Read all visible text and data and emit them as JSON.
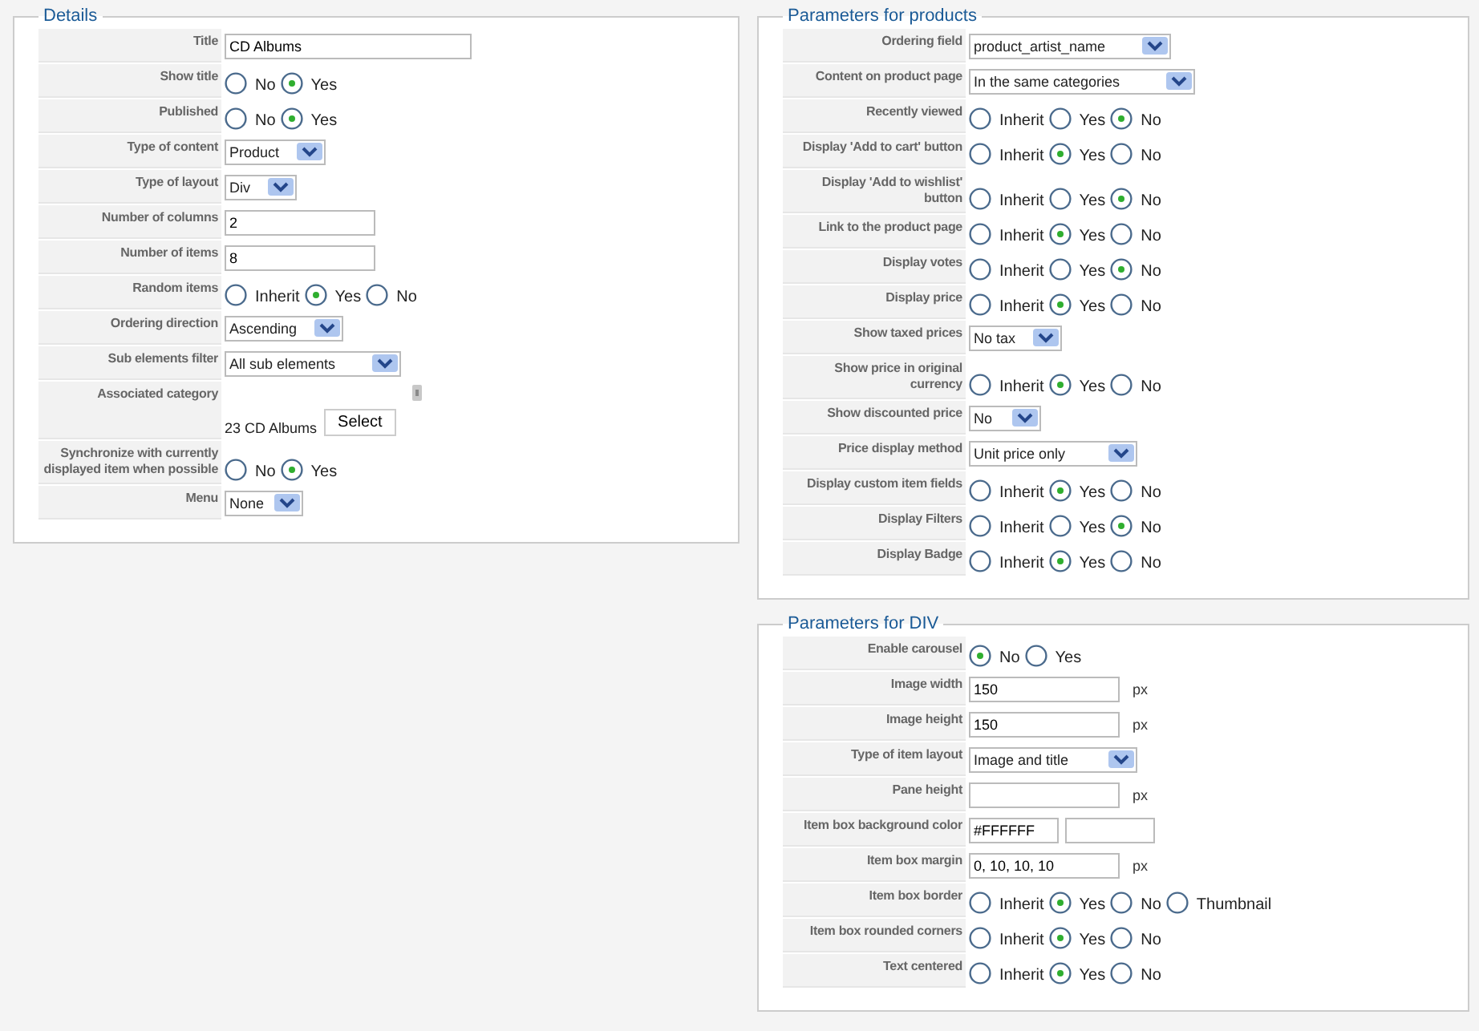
{
  "panels": [
    {
      "title": "Details",
      "rows": [
        {
          "label": "Title",
          "kind": "text",
          "value": "CD Albums"
        },
        {
          "label": "Show title",
          "kind": "radio",
          "options": [
            {
              "label": "No",
              "selected": false
            },
            {
              "label": "Yes",
              "selected": true
            }
          ]
        },
        {
          "label": "Published",
          "kind": "radio",
          "options": [
            {
              "label": "No",
              "selected": false
            },
            {
              "label": "Yes",
              "selected": true
            }
          ]
        },
        {
          "label": "Type of content",
          "kind": "select",
          "value": "Product"
        },
        {
          "label": "Type of layout",
          "kind": "select",
          "value": "Div"
        },
        {
          "label": "Number of columns",
          "kind": "text",
          "value": "2"
        },
        {
          "label": "Number of items",
          "kind": "text",
          "value": "8"
        },
        {
          "label": "Random items",
          "kind": "radio",
          "options": [
            {
              "label": "Inherit",
              "selected": false
            },
            {
              "label": "Yes",
              "selected": true
            },
            {
              "label": "No",
              "selected": false
            }
          ]
        },
        {
          "label": "Ordering direction",
          "kind": "select",
          "value": "Ascending"
        },
        {
          "label": "Sub elements filter",
          "kind": "select",
          "value": "All sub elements"
        },
        {
          "label": "Associated category",
          "kind": "category",
          "value": "23 CD Albums",
          "button": "Select"
        },
        {
          "label": "Synchronize with currently displayed item when possible",
          "kind": "radio",
          "options": [
            {
              "label": "No",
              "selected": false
            },
            {
              "label": "Yes",
              "selected": true
            }
          ]
        },
        {
          "label": "Menu",
          "kind": "select",
          "value": "None"
        }
      ]
    },
    {
      "title": "Parameters for products",
      "rows": [
        {
          "label": "Ordering field",
          "kind": "select",
          "value": "product_artist_name"
        },
        {
          "label": "Content on product page",
          "kind": "select",
          "value": "In the same categories"
        },
        {
          "label": "Recently viewed",
          "kind": "radio",
          "options": [
            {
              "label": "Inherit",
              "selected": false
            },
            {
              "label": "Yes",
              "selected": false
            },
            {
              "label": "No",
              "selected": true
            }
          ]
        },
        {
          "label": "Display 'Add to cart' button",
          "kind": "radio",
          "options": [
            {
              "label": "Inherit",
              "selected": false
            },
            {
              "label": "Yes",
              "selected": true
            },
            {
              "label": "No",
              "selected": false
            }
          ]
        },
        {
          "label": "Display 'Add to wishlist' button",
          "kind": "radio",
          "options": [
            {
              "label": "Inherit",
              "selected": false
            },
            {
              "label": "Yes",
              "selected": false
            },
            {
              "label": "No",
              "selected": true
            }
          ]
        },
        {
          "label": "Link to the product page",
          "kind": "radio",
          "options": [
            {
              "label": "Inherit",
              "selected": false
            },
            {
              "label": "Yes",
              "selected": true
            },
            {
              "label": "No",
              "selected": false
            }
          ]
        },
        {
          "label": "Display votes",
          "kind": "radio",
          "options": [
            {
              "label": "Inherit",
              "selected": false
            },
            {
              "label": "Yes",
              "selected": false
            },
            {
              "label": "No",
              "selected": true
            }
          ]
        },
        {
          "label": "Display price",
          "kind": "radio",
          "options": [
            {
              "label": "Inherit",
              "selected": false
            },
            {
              "label": "Yes",
              "selected": true
            },
            {
              "label": "No",
              "selected": false
            }
          ]
        },
        {
          "label": "Show taxed prices",
          "kind": "select",
          "value": "No tax"
        },
        {
          "label": "Show price in original currency",
          "kind": "radio",
          "options": [
            {
              "label": "Inherit",
              "selected": false
            },
            {
              "label": "Yes",
              "selected": true
            },
            {
              "label": "No",
              "selected": false
            }
          ]
        },
        {
          "label": "Show discounted price",
          "kind": "select",
          "value": "No"
        },
        {
          "label": "Price display method",
          "kind": "select",
          "value": "Unit price only"
        },
        {
          "label": "Display custom item fields",
          "kind": "radio",
          "options": [
            {
              "label": "Inherit",
              "selected": false
            },
            {
              "label": "Yes",
              "selected": true
            },
            {
              "label": "No",
              "selected": false
            }
          ]
        },
        {
          "label": "Display Filters",
          "kind": "radio",
          "options": [
            {
              "label": "Inherit",
              "selected": false
            },
            {
              "label": "Yes",
              "selected": false
            },
            {
              "label": "No",
              "selected": true
            }
          ]
        },
        {
          "label": "Display Badge",
          "kind": "radio",
          "options": [
            {
              "label": "Inherit",
              "selected": false
            },
            {
              "label": "Yes",
              "selected": true
            },
            {
              "label": "No",
              "selected": false
            }
          ]
        }
      ]
    },
    {
      "title": "Parameters for DIV",
      "rows": [
        {
          "label": "Enable carousel",
          "kind": "radio",
          "options": [
            {
              "label": "No",
              "selected": true
            },
            {
              "label": "Yes",
              "selected": false
            }
          ]
        },
        {
          "label": "Image width",
          "kind": "text",
          "value": "150",
          "unit": "px"
        },
        {
          "label": "Image height",
          "kind": "text",
          "value": "150",
          "unit": "px"
        },
        {
          "label": "Type of item layout",
          "kind": "select",
          "value": "Image and title"
        },
        {
          "label": "Pane height",
          "kind": "text",
          "unit": "px"
        },
        {
          "label": "Item box background color",
          "kind": "color",
          "value": "#FFFFFF"
        },
        {
          "label": "Item box margin",
          "kind": "text",
          "value": "0, 10, 10, 10",
          "unit": "px"
        },
        {
          "label": "Item box border",
          "kind": "radio",
          "options": [
            {
              "label": "Inherit",
              "selected": false
            },
            {
              "label": "Yes",
              "selected": true
            },
            {
              "label": "No",
              "selected": false
            },
            {
              "label": "Thumbnail",
              "selected": false
            }
          ]
        },
        {
          "label": "Item box rounded corners",
          "kind": "radio",
          "options": [
            {
              "label": "Inherit",
              "selected": false
            },
            {
              "label": "Yes",
              "selected": true
            },
            {
              "label": "No",
              "selected": false
            }
          ]
        },
        {
          "label": "Text centered",
          "kind": "radio",
          "options": [
            {
              "label": "Inherit",
              "selected": false
            },
            {
              "label": "Yes",
              "selected": true
            },
            {
              "label": "No",
              "selected": false
            }
          ]
        }
      ]
    }
  ]
}
